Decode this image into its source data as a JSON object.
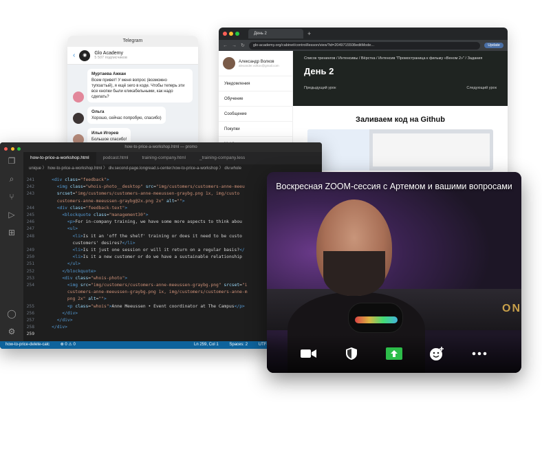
{
  "telegram": {
    "window_title": "Telegram",
    "channel_name": "Glo Academy",
    "channel_subtitle": "5 507 подписчиков",
    "messages": [
      {
        "author": "Муртаева Ажкан",
        "text": "Всем привет! У меня вопрос (возможно тупоагтый), я ещё sero в коде. Чтобы теперь эти все кнопки были кликабельными, как надо сделать?"
      },
      {
        "author": "Ольга",
        "text": "Хорошо, сейчас попробую, спасибо)"
      },
      {
        "author": "Илья Игорев",
        "text": "Большое спасибо!"
      }
    ]
  },
  "browser": {
    "tab_title": "День 2",
    "url": "glo-academy.org/cabinet/control/lesson/view?id=2049715508editMode...",
    "update_label": "Update",
    "user_name": "Александр Волков",
    "user_email": "alexander.volkov@gmail.com",
    "menu": [
      "Уведомления",
      "Обучение",
      "Сообщение",
      "Покупки",
      "Mobile"
    ],
    "breadcrumbs": "Список тренингов / Интенсивы / Вёрстка / Интенсив \"Промостраница к фильму «Веном 2»\" / Задания",
    "day_title": "День 2",
    "prev_lesson": "Предыдущий урок",
    "next_lesson": "Следующий урок",
    "lesson_heading": "Заливаем код на Github"
  },
  "editor": {
    "window_title": "how-to-price-a-workshop.html — promo",
    "tabs": [
      "how-to-price-a-workshop.html",
      "podcast.html",
      "training-company.html",
      "_training-company.less"
    ],
    "breadcrumb": "unique 〉 how-to-price-a-workshop.html 〉 div.second-page.longread.s-center.how-to-price-a-workshop 〉 div.whole",
    "lines": [
      {
        "n": "241",
        "html": "    <span class='tag'>&lt;div</span> <span class='attr'>class</span>=<span class='str'>\"feedback\"</span><span class='tag'>&gt;</span>"
      },
      {
        "n": "242",
        "html": "      <span class='tag'>&lt;img</span> <span class='attr'>class</span>=<span class='str'>\"whois-photo__desktop\"</span> <span class='attr'>src</span>=<span class='str'>\"img/customers/customers-anne-meeu</span>"
      },
      {
        "n": "243",
        "html": "      <span class='attr'>srcset</span>=<span class='str'>\"img/customers/customers-anne-meeussen-graybg.png 1x, img/custo</span>"
      },
      {
        "n": "",
        "html": "      <span class='str'>customers-anne-meeussen-graybg@2x.png 2x\"</span> <span class='attr'>alt</span>=<span class='str'>\"\"</span><span class='tag'>&gt;</span>"
      },
      {
        "n": "244",
        "html": "      <span class='tag'>&lt;div</span> <span class='attr'>class</span>=<span class='str'>\"feedback-text\"</span><span class='tag'>&gt;</span>"
      },
      {
        "n": "245",
        "html": "        <span class='tag'>&lt;blockquote</span> <span class='attr'>class</span>=<span class='str'>\"management30\"</span><span class='tag'>&gt;</span>"
      },
      {
        "n": "246",
        "html": "          <span class='tag'>&lt;p&gt;</span>For in-company training, we have some more aspects to think abou"
      },
      {
        "n": "247",
        "html": "          <span class='tag'>&lt;ul&gt;</span>"
      },
      {
        "n": "248",
        "html": "            <span class='tag'>&lt;li&gt;</span>Is it an 'off the shelf' training or does it need to be custo"
      },
      {
        "n": "",
        "html": "            customers' desires?<span class='tag'>&lt;/li&gt;</span>"
      },
      {
        "n": "249",
        "html": "            <span class='tag'>&lt;li&gt;</span>Is it just one session or will it return on a regular basis?<span class='tag'>&lt;/</span>"
      },
      {
        "n": "250",
        "html": "            <span class='tag'>&lt;li&gt;</span>Is it a new customer or do we have a sustainable relationship"
      },
      {
        "n": "251",
        "html": "          <span class='tag'>&lt;/ul&gt;</span>"
      },
      {
        "n": "252",
        "html": "        <span class='tag'>&lt;/blockquote&gt;</span>"
      },
      {
        "n": "253",
        "html": "        <span class='tag'>&lt;div</span> <span class='attr'>class</span>=<span class='str'>\"whois-photo\"</span><span class='tag'>&gt;</span>"
      },
      {
        "n": "254",
        "html": "          <span class='tag'>&lt;img</span> <span class='attr'>src</span>=<span class='str'>\"img/customers/customers-anne-meeussen-graybg.png\"</span> <span class='attr'>srcset</span>=<span class='str'>\"i</span>"
      },
      {
        "n": "",
        "html": "          <span class='str'>customers-anne-meeussen-graybg.png 1x, img/customers/customers-anne-m</span>"
      },
      {
        "n": "",
        "html": "          <span class='str'>png 2x\"</span> <span class='attr'>alt</span>=<span class='str'>\"\"</span><span class='tag'>&gt;</span>"
      },
      {
        "n": "255",
        "html": "          <span class='tag'>&lt;p</span> <span class='attr'>class</span>=<span class='str'>\"whois\"</span><span class='tag'>&gt;</span>Anne Meeussen • Event coordinator at The Campus<span class='tag'>&lt;/p&gt;</span>"
      },
      {
        "n": "256",
        "html": "        <span class='tag'>&lt;/div&gt;</span>"
      },
      {
        "n": "257",
        "html": "      <span class='tag'>&lt;/div&gt;</span>"
      },
      {
        "n": "258",
        "html": "    <span class='tag'>&lt;/div&gt;</span>"
      },
      {
        "n": "259",
        "html": ""
      }
    ],
    "status_branch": "how-to-price-delete-calc",
    "status_problems": "⊗ 0 ⚠ 0",
    "status_position": "Ln 259, Col 1",
    "status_spaces": "Spaces: 2",
    "status_encoding": "UTF-"
  },
  "video": {
    "title": "Воскресная ZOOM-сессия с Артемом и вашими вопросами",
    "sign_text": "ON",
    "controls": [
      "camera-icon",
      "shield-icon",
      "share-screen-icon",
      "emoji-add-icon",
      "more-icon"
    ],
    "accent_green": "#2dbd4a"
  }
}
